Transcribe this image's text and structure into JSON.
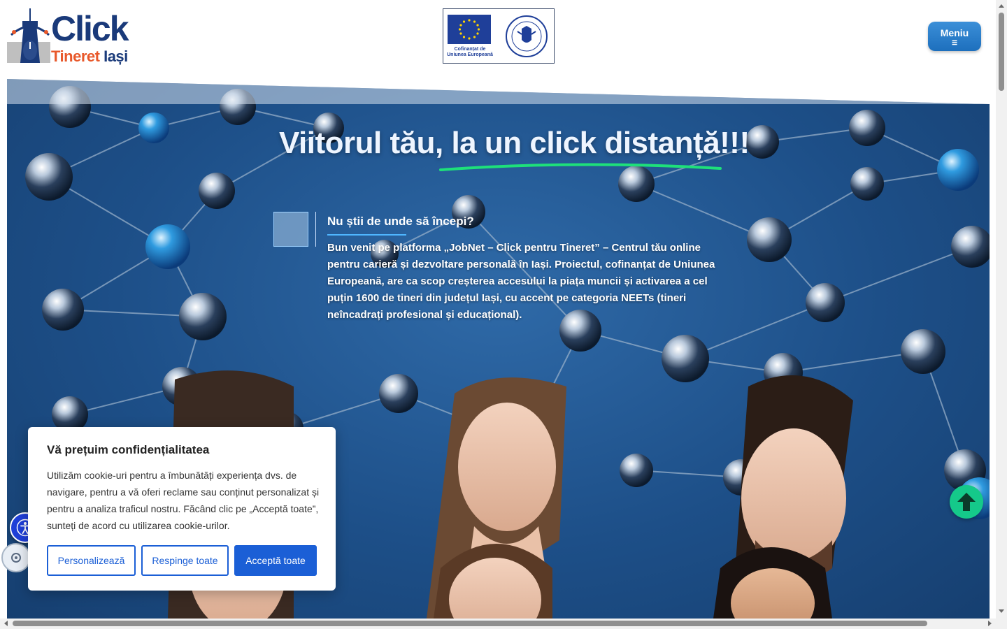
{
  "header": {
    "logo": {
      "title": "Click",
      "subtitle_part1": "Tineret",
      "subtitle_part2": "Iași"
    },
    "sponsor": {
      "eu_caption": "Cofinanțat de Uniunea Europeană",
      "gov_seal_text": "GUVERNUL ROMÂNIEI"
    },
    "menu_label": "Meniu",
    "menu_icon": "list-icon"
  },
  "hero": {
    "title_part1": "Viitorul tău,",
    "title_part2": "la un click distanță!!!",
    "intro_heading": "Nu știi de unde să începi?",
    "intro_text": "Bun venit pe platforma „JobNet – Click pentru Tineret” – Centrul tău online pentru carieră și dezvoltare personală în Iași. Proiectul, cofinanțat de Uniunea Europeană, are ca scop creșterea accesului la piața muncii și activarea a cel puțin 1600 de tineri din județul Iași, cu accent pe categoria NEETs (tineri neîncadrați profesional și educațional)."
  },
  "cookie": {
    "title": "Vă prețuim confidențialitatea",
    "text": "Utilizăm cookie-uri pentru a îmbunătăți experiența dvs. de navigare, pentru a vă oferi reclame sau conținut personalizat și pentru a analiza traficul nostru. Făcând clic pe „Acceptă toate”, sunteți de acord cu utilizarea cookie-urilor.",
    "btn_customize": "Personalizează",
    "btn_reject": "Respinge toate",
    "btn_accept": "Acceptă toate"
  },
  "colors": {
    "brand_navy": "#1a3a7a",
    "brand_orange": "#e8582a",
    "accent_blue": "#1b5fd6",
    "scroll_top_green": "#15c98a",
    "underline_green": "#1ee07a"
  },
  "icons": {
    "scroll_top": "arrow-up-icon",
    "accessibility": "accessibility-icon",
    "side_tab": "cookie-settings-icon"
  }
}
